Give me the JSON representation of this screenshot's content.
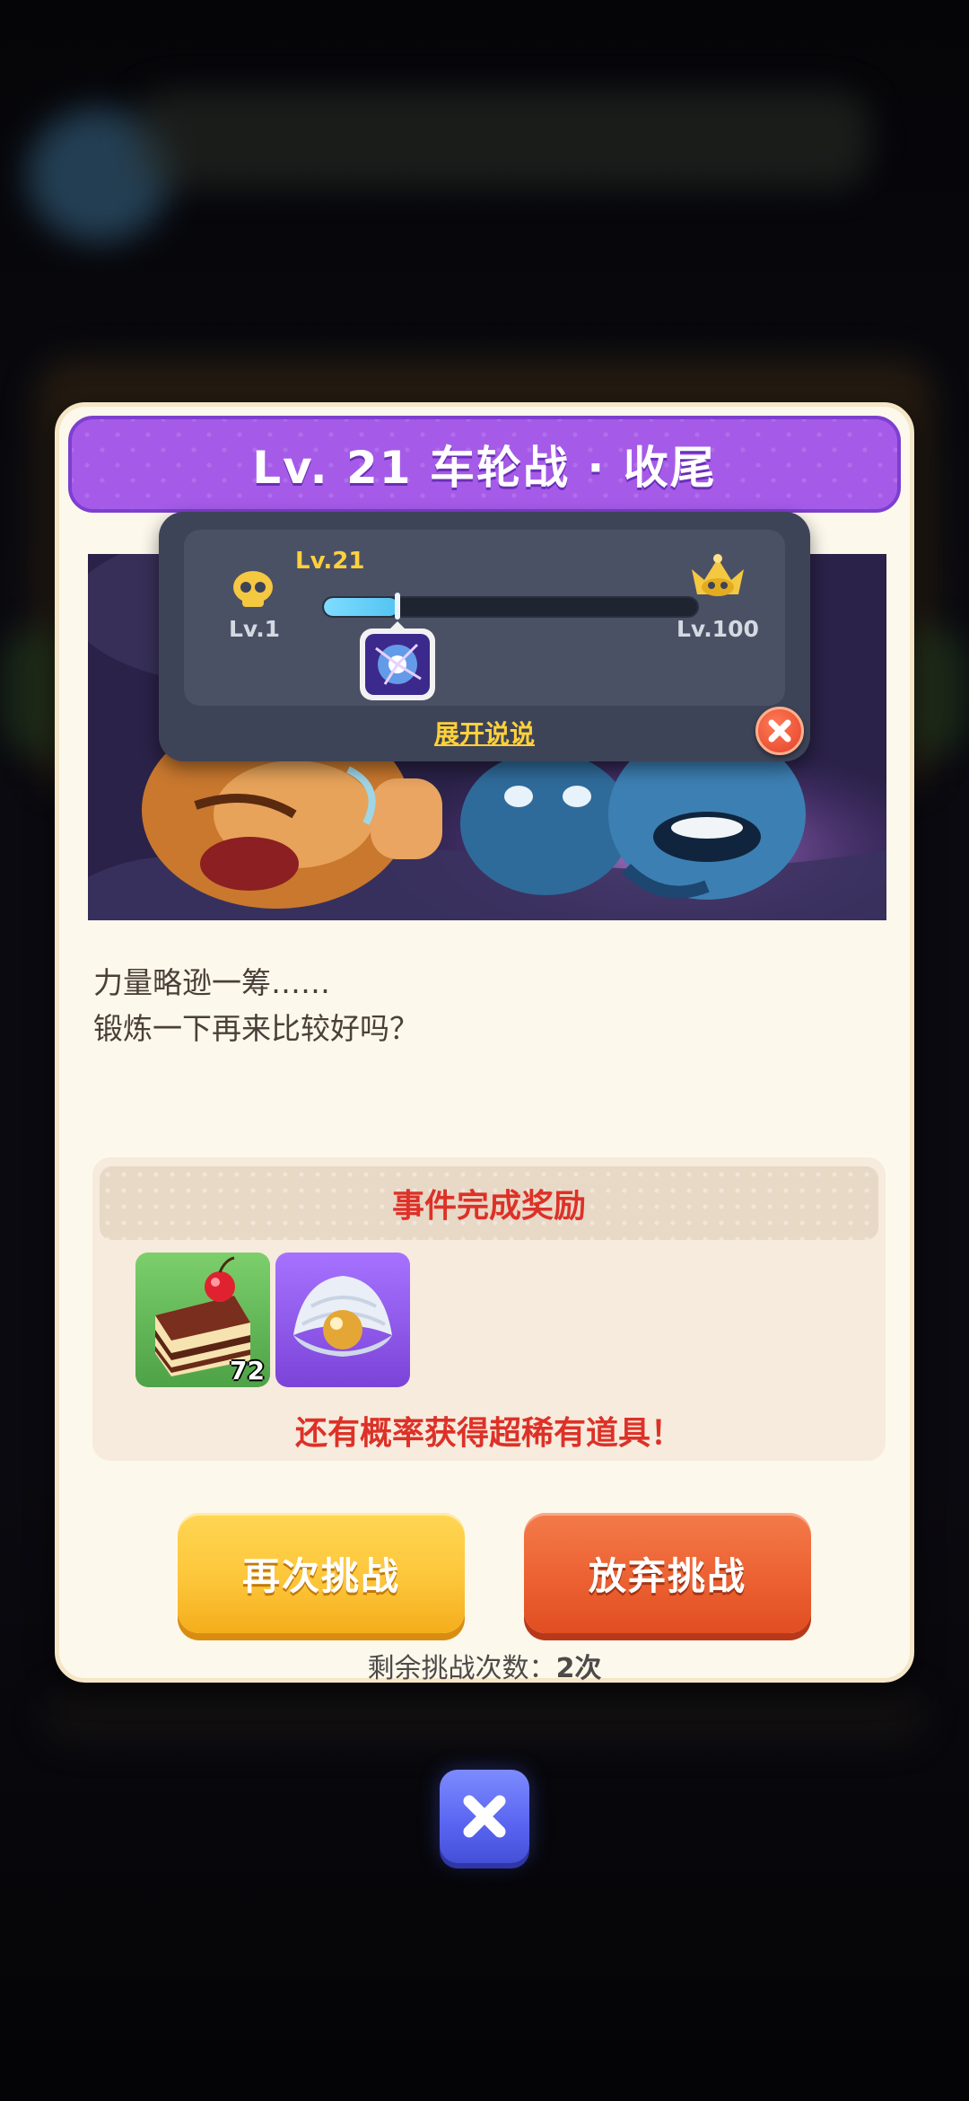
{
  "title": "Lv. 21 车轮战 · 收尾",
  "level_popup": {
    "current_level_label": "Lv.21",
    "min_level_label": "Lv.1",
    "max_level_label": "Lv.100",
    "progress_fraction": 0.2,
    "expand_link": "展开说说",
    "min_icon": "skull-icon",
    "max_icon": "crown-icon"
  },
  "dialog_text": {
    "line1": "力量略逊一筹……",
    "line2": "锻炼一下再来比较好吗？"
  },
  "rewards": {
    "header": "事件完成奖励",
    "items": [
      {
        "icon": "cake-icon",
        "count": "72"
      },
      {
        "icon": "pearl-shell-icon",
        "count": ""
      }
    ],
    "note": "还有概率获得超稀有道具！"
  },
  "buttons": {
    "retry": "再次挑战",
    "give_up": "放弃挑战"
  },
  "remaining": {
    "label": "剩余挑战次数：",
    "value": "2次"
  },
  "colors": {
    "title_purple": "#a55be8",
    "retry_yellow": "#fdc63a",
    "giveup_orange": "#ec6132",
    "reward_red": "#dd3128",
    "link_yellow": "#ffd13b"
  }
}
